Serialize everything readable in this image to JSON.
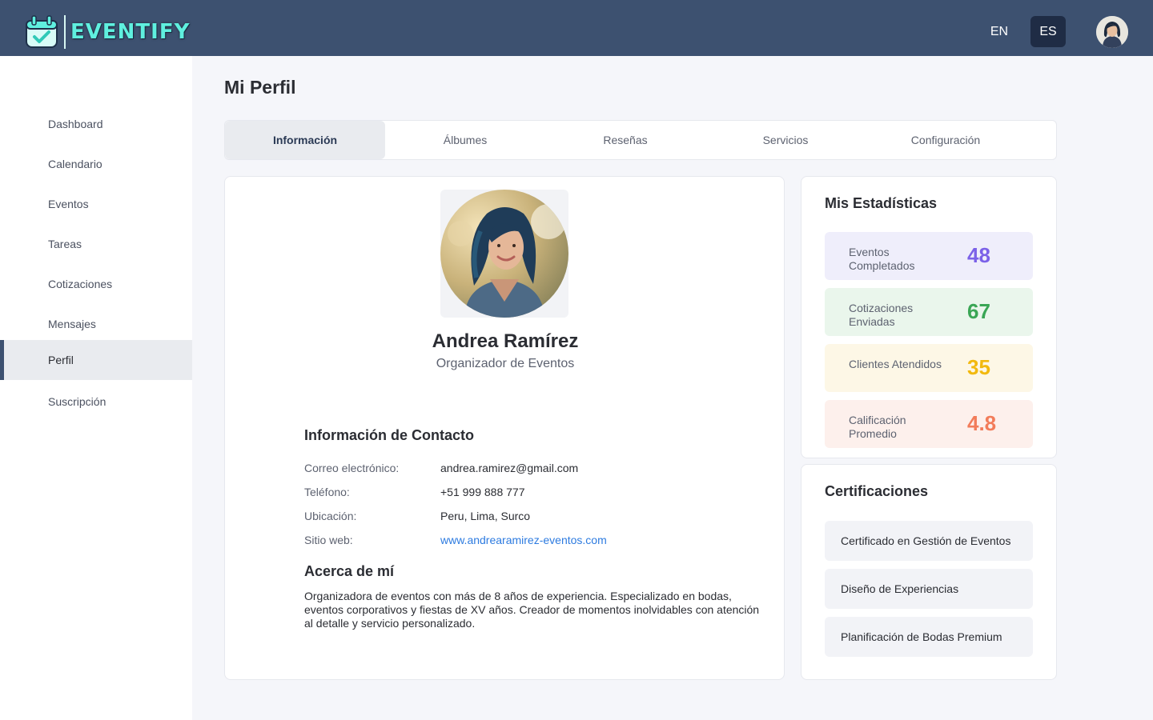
{
  "header": {
    "logo_text": "EVENTIFY",
    "logo_icon": "calendar-check-icon",
    "languages": [
      "EN",
      "ES"
    ],
    "active_language": "ES"
  },
  "sidebar": {
    "items": [
      {
        "label": "Dashboard"
      },
      {
        "label": "Calendario"
      },
      {
        "label": "Eventos"
      },
      {
        "label": "Tareas"
      },
      {
        "label": "Cotizaciones"
      },
      {
        "label": "Mensajes"
      },
      {
        "label": "Perfil",
        "active": true
      },
      {
        "label": "Suscripción"
      }
    ]
  },
  "page": {
    "title": "Mi Perfil",
    "tabs": [
      {
        "label": "Información",
        "active": true
      },
      {
        "label": "Álbumes"
      },
      {
        "label": "Reseñas"
      },
      {
        "label": "Servicios"
      },
      {
        "label": "Configuración"
      }
    ]
  },
  "profile": {
    "name": "Andrea Ramírez",
    "role": "Organizador de Eventos",
    "contact_title": "Información de Contacto",
    "contact": [
      {
        "label": "Correo electrónico:",
        "value": "andrea.ramirez@gmail.com"
      },
      {
        "label": "Teléfono:",
        "value": "+51 999 888 777"
      },
      {
        "label": "Ubicación:",
        "value": "Peru, Lima, Surco"
      },
      {
        "label": "Sitio web:",
        "value": "www.andrearamirez-eventos.com",
        "link": true
      }
    ],
    "about_title": "Acerca de mí",
    "about_text": "Organizadora de eventos con más de 8 años de experiencia. Especializado en bodas, eventos corporativos y fiestas de XV años. Creador de momentos inolvidables con atención al detalle y servicio personalizado."
  },
  "stats": {
    "title": "Mis Estadísticas",
    "items": [
      {
        "label": "Eventos Completados",
        "value": "48",
        "color": "#7b61e8",
        "bg": "#efeefb"
      },
      {
        "label": "Cotizaciones Enviadas",
        "value": "67",
        "color": "#3aa655",
        "bg": "#eaf6ec"
      },
      {
        "label": "Clientes Atendidos",
        "value": "35",
        "color": "#f2b90f",
        "bg": "#fdf7e6"
      },
      {
        "label": "Calificación Promedio",
        "value": "4.8",
        "color": "#f27c5a",
        "bg": "#fdf0ec"
      }
    ]
  },
  "certifications": {
    "title": "Certificaciones",
    "items": [
      {
        "label": "Certificado en Gestión de Eventos"
      },
      {
        "label": "Diseño de Experiencias"
      },
      {
        "label": "Planificación de Bodas Premium"
      }
    ]
  },
  "colors": {
    "header_bg": "#3d5170",
    "accent_logo": "#5ff0df",
    "link": "#2d7be0"
  }
}
